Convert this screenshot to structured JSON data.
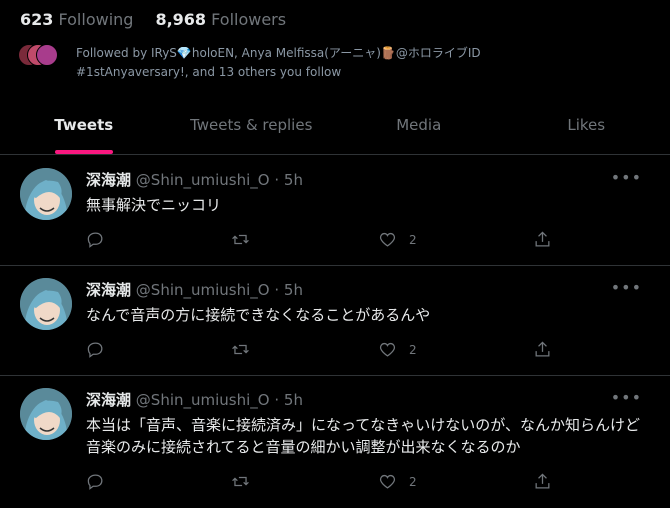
{
  "profile": {
    "following_count": "623",
    "following_label": "Following",
    "followers_count": "8,968",
    "followers_label": "Followers",
    "followed_by_text": "Followed by IRyS💎holoEN, Anya Melfissa(アーニャ)🪵@ホロライブID #1stAnyaversary!, and 13 others you follow"
  },
  "tabs": [
    {
      "label": "Tweets",
      "active": true
    },
    {
      "label": "Tweets & replies",
      "active": false
    },
    {
      "label": "Media",
      "active": false
    },
    {
      "label": "Likes",
      "active": false
    }
  ],
  "tweets": [
    {
      "name": "深海潮",
      "handle": "@Shin_umiushi_O",
      "time": "· 5h",
      "text": "無事解決でニッコリ",
      "likes": "2"
    },
    {
      "name": "深海潮",
      "handle": "@Shin_umiushi_O",
      "time": "· 5h",
      "text": "なんで音声の方に接続できなくなることがあるんや",
      "likes": "2"
    },
    {
      "name": "深海潮",
      "handle": "@Shin_umiushi_O",
      "time": "· 5h",
      "text": "本当は「音声、音楽に接続済み」になってなきゃいけないのが、なんか知らんけど音楽のみに接続されてると音量の細かい調整が出来なくなるのか",
      "likes": "2"
    }
  ],
  "icons": {
    "more": "more-icon",
    "reply": "reply-icon",
    "retweet": "retweet-icon",
    "like": "like-icon",
    "share": "share-icon"
  },
  "colors": {
    "accent": "#f91880",
    "muted": "#71767b",
    "background": "#000000"
  }
}
